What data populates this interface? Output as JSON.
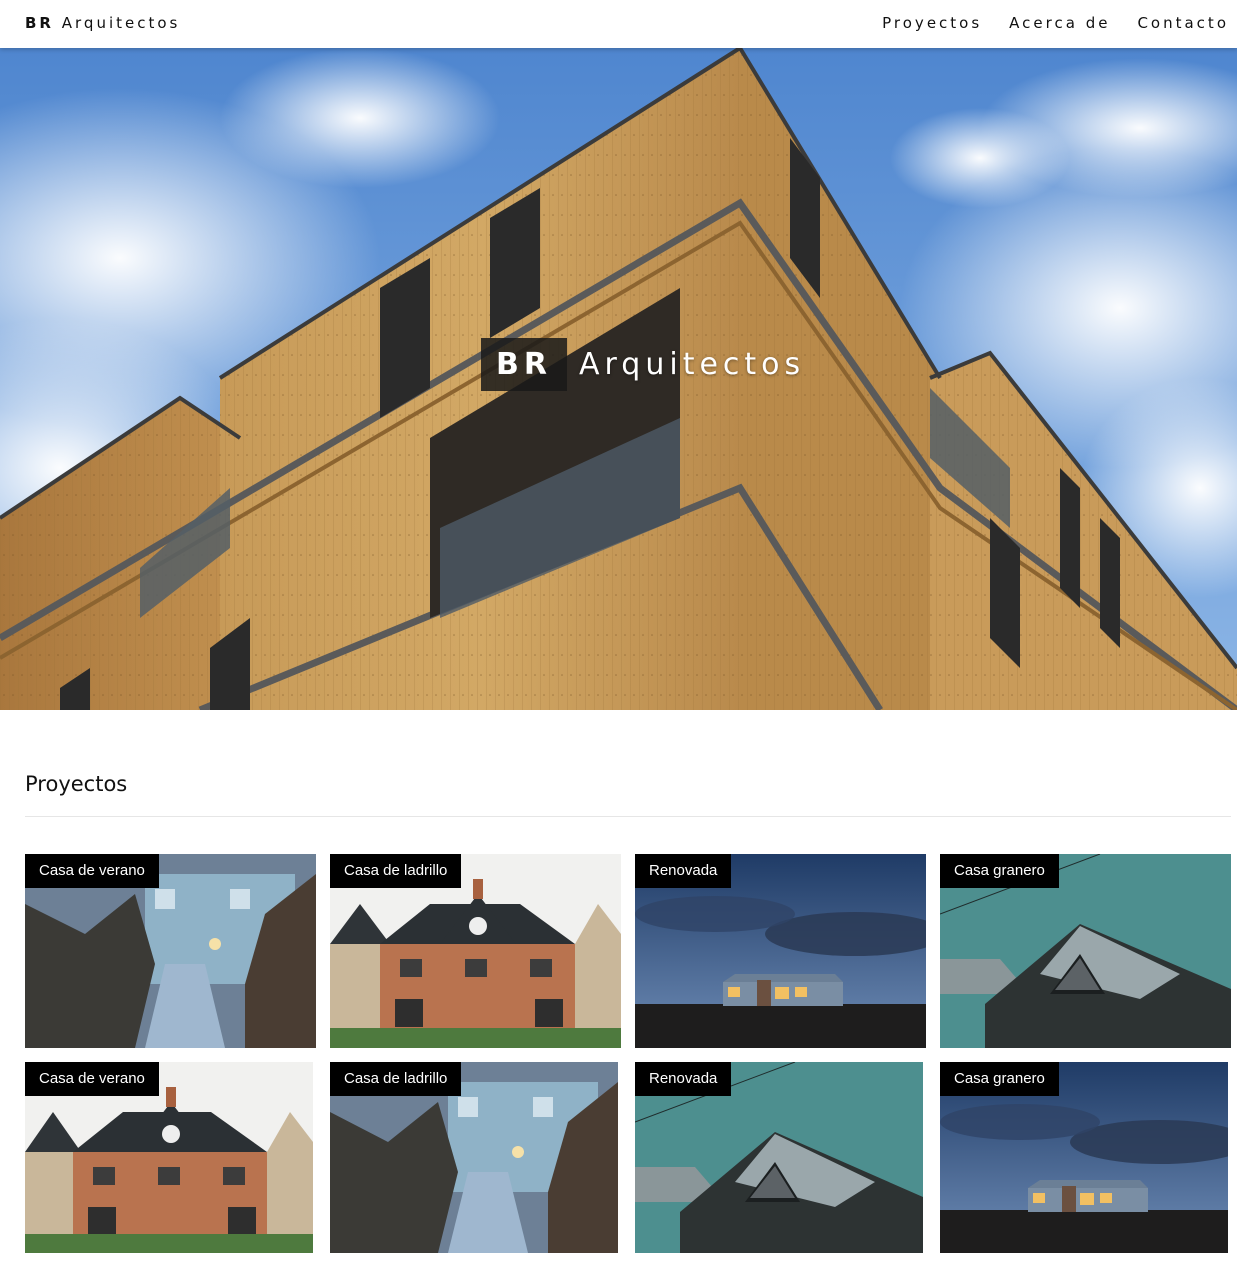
{
  "header": {
    "brand_bold": "BR",
    "brand_rest": "Arquitectos",
    "nav": [
      {
        "label": "Proyectos"
      },
      {
        "label": "Acerca de"
      },
      {
        "label": "Contacto"
      }
    ]
  },
  "hero": {
    "title_bold": "BR",
    "title_rest": "Arquitectos"
  },
  "projects": {
    "heading": "Proyectos",
    "items": [
      {
        "label": "Casa de verano",
        "image": "boardwalk-house"
      },
      {
        "label": "Casa de ladrillo",
        "image": "brick-house"
      },
      {
        "label": "Renovada",
        "image": "night-cabin"
      },
      {
        "label": "Casa granero",
        "image": "barn-house"
      },
      {
        "label": "Casa de verano",
        "image": "brick-house"
      },
      {
        "label": "Casa de ladrillo",
        "image": "boardwalk-house"
      },
      {
        "label": "Renovada",
        "image": "barn-house"
      },
      {
        "label": "Casa granero",
        "image": "night-cabin"
      }
    ]
  }
}
